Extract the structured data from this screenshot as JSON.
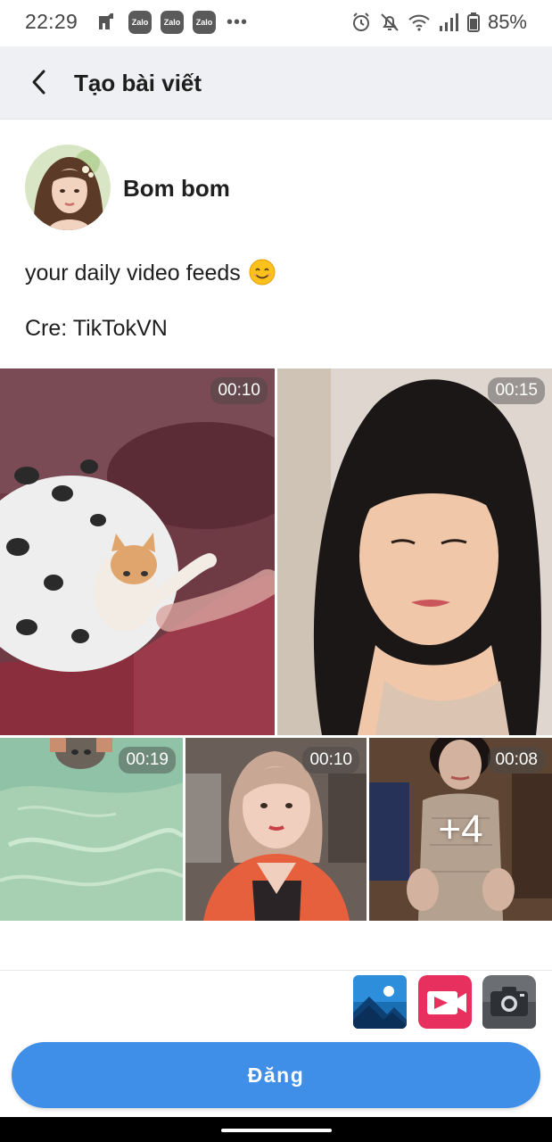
{
  "status_bar": {
    "time": "22:29",
    "notification_icons": [
      "Zalo",
      "Zalo",
      "Zalo"
    ],
    "more_indicator": "•••",
    "battery": "85%"
  },
  "header": {
    "title": "Tạo bài viết"
  },
  "author": {
    "name": "Bom bom"
  },
  "post": {
    "line1": "your daily video feeds",
    "line2": "Cre: TikTokVN"
  },
  "media": [
    {
      "duration": "00:10"
    },
    {
      "duration": "00:15"
    },
    {
      "duration": "00:19"
    },
    {
      "duration": "00:10"
    },
    {
      "duration": "00:08",
      "more": "+4"
    }
  ],
  "toolbar": {
    "icons": [
      "gallery-icon",
      "video-icon",
      "camera-icon"
    ]
  },
  "submit": {
    "label": "Đăng"
  },
  "colors": {
    "accent": "#3f8ee8",
    "header_bg": "#eef0f3"
  }
}
